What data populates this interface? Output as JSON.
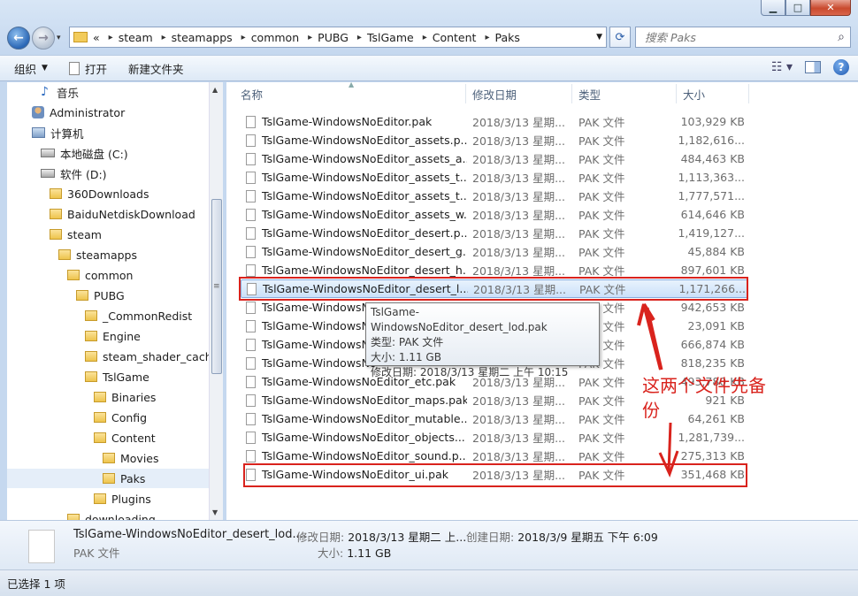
{
  "address": {
    "overflow": "«",
    "path": [
      "steam",
      "steamapps",
      "common",
      "PUBG",
      "TslGame",
      "Content",
      "Paks"
    ]
  },
  "search": {
    "placeholder": "搜索 Paks"
  },
  "toolbar": {
    "organize": "组织",
    "open": "打开",
    "new_folder": "新建文件夹"
  },
  "nav": [
    {
      "label": "音乐",
      "icon": "music-icon"
    },
    {
      "label": "Administrator",
      "icon": "user-folder-icon"
    },
    {
      "label": "计算机",
      "icon": "computer-icon"
    },
    {
      "label": "本地磁盘 (C:)",
      "icon": "drive-icon"
    },
    {
      "label": "软件 (D:)",
      "icon": "drive-icon"
    },
    {
      "label": "360Downloads",
      "icon": "folder-icon"
    },
    {
      "label": "BaiduNetdiskDownload",
      "icon": "folder-icon"
    },
    {
      "label": "steam",
      "icon": "folder-icon"
    },
    {
      "label": "steamapps",
      "icon": "folder-icon"
    },
    {
      "label": "common",
      "icon": "folder-icon"
    },
    {
      "label": "PUBG",
      "icon": "folder-icon"
    },
    {
      "label": "_CommonRedist",
      "icon": "folder-icon"
    },
    {
      "label": "Engine",
      "icon": "folder-icon"
    },
    {
      "label": "steam_shader_cache",
      "icon": "folder-icon"
    },
    {
      "label": "TslGame",
      "icon": "folder-icon"
    },
    {
      "label": "Binaries",
      "icon": "folder-icon"
    },
    {
      "label": "Config",
      "icon": "folder-icon"
    },
    {
      "label": "Content",
      "icon": "folder-icon"
    },
    {
      "label": "Movies",
      "icon": "folder-icon"
    },
    {
      "label": "Paks",
      "icon": "folder-icon"
    },
    {
      "label": "Plugins",
      "icon": "folder-icon"
    },
    {
      "label": "downloading",
      "icon": "folder-icon"
    }
  ],
  "columns": {
    "name": "名称",
    "date": "修改日期",
    "type": "类型",
    "size": "大小"
  },
  "files": [
    {
      "name": "TslGame-WindowsNoEditor.pak",
      "date": "2018/3/13 星期...",
      "type": "PAK 文件",
      "size": "103,929 KB"
    },
    {
      "name": "TslGame-WindowsNoEditor_assets.p...",
      "date": "2018/3/13 星期...",
      "type": "PAK 文件",
      "size": "1,182,616..."
    },
    {
      "name": "TslGame-WindowsNoEditor_assets_a...",
      "date": "2018/3/13 星期...",
      "type": "PAK 文件",
      "size": "484,463 KB"
    },
    {
      "name": "TslGame-WindowsNoEditor_assets_t...",
      "date": "2018/3/13 星期...",
      "type": "PAK 文件",
      "size": "1,113,363..."
    },
    {
      "name": "TslGame-WindowsNoEditor_assets_t...",
      "date": "2018/3/13 星期...",
      "type": "PAK 文件",
      "size": "1,777,571..."
    },
    {
      "name": "TslGame-WindowsNoEditor_assets_w...",
      "date": "2018/3/13 星期...",
      "type": "PAK 文件",
      "size": "614,646 KB"
    },
    {
      "name": "TslGame-WindowsNoEditor_desert.p...",
      "date": "2018/3/13 星期...",
      "type": "PAK 文件",
      "size": "1,419,127..."
    },
    {
      "name": "TslGame-WindowsNoEditor_desert_g...",
      "date": "2018/3/13 星期...",
      "type": "PAK 文件",
      "size": "45,884 KB"
    },
    {
      "name": "TslGame-WindowsNoEditor_desert_h...",
      "date": "2018/3/13 星期...",
      "type": "PAK 文件",
      "size": "897,601 KB"
    },
    {
      "name": "TslGame-WindowsNoEditor_desert_l...",
      "date": "2018/3/13 星期...",
      "type": "PAK 文件",
      "size": "1,171,266..."
    },
    {
      "name": "TslGame-WindowsNo",
      "date": "",
      "type": "PAK 文件",
      "size": "942,653 KB"
    },
    {
      "name": "TslGame-WindowsNo",
      "date": "",
      "type": "PAK 文件",
      "size": "23,091 KB"
    },
    {
      "name": "TslGame-WindowsNo",
      "date": "",
      "type": "PAK 文件",
      "size": "666,874 KB"
    },
    {
      "name": "TslGame-WindowsNo",
      "date": "",
      "type": "PAK 文件",
      "size": "818,235 KB"
    },
    {
      "name": "TslGame-WindowsNoEditor_etc.pak",
      "date": "2018/3/13 星期...",
      "type": "PAK 文件",
      "size": "493,780 KB"
    },
    {
      "name": "TslGame-WindowsNoEditor_maps.pak",
      "date": "2018/3/13 星期...",
      "type": "PAK 文件",
      "size": "921 KB"
    },
    {
      "name": "TslGame-WindowsNoEditor_mutable...",
      "date": "2018/3/13 星期...",
      "type": "PAK 文件",
      "size": "64,261 KB"
    },
    {
      "name": "TslGame-WindowsNoEditor_objects...",
      "date": "2018/3/13 星期...",
      "type": "PAK 文件",
      "size": "1,281,739..."
    },
    {
      "name": "TslGame-WindowsNoEditor_sound.p...",
      "date": "2018/3/13 星期...",
      "type": "PAK 文件",
      "size": "275,313 KB"
    },
    {
      "name": "TslGame-WindowsNoEditor_ui.pak",
      "date": "2018/3/13 星期...",
      "type": "PAK 文件",
      "size": "351,468 KB"
    }
  ],
  "tooltip": {
    "title": "TslGame-WindowsNoEditor_desert_lod.pak",
    "type": "类型: PAK 文件",
    "size": "大小: 1.11 GB",
    "modified": "修改日期: 2018/3/13 星期二 上午 10:15"
  },
  "annotation": "这两个文件先备份",
  "details": {
    "name": "TslGame-WindowsNoEditor_desert_lod....",
    "type": "PAK 文件",
    "modified_label": "修改日期:",
    "modified_value": "2018/3/13 星期二 上...",
    "created_label": "创建日期:",
    "created_value": "2018/3/9 星期五 下午 6:09",
    "size_label": "大小:",
    "size_value": "1.11 GB"
  },
  "status": "已选择 1 项",
  "colors": {
    "highlight": "#d9231d",
    "selection": "#cbe1f9"
  }
}
